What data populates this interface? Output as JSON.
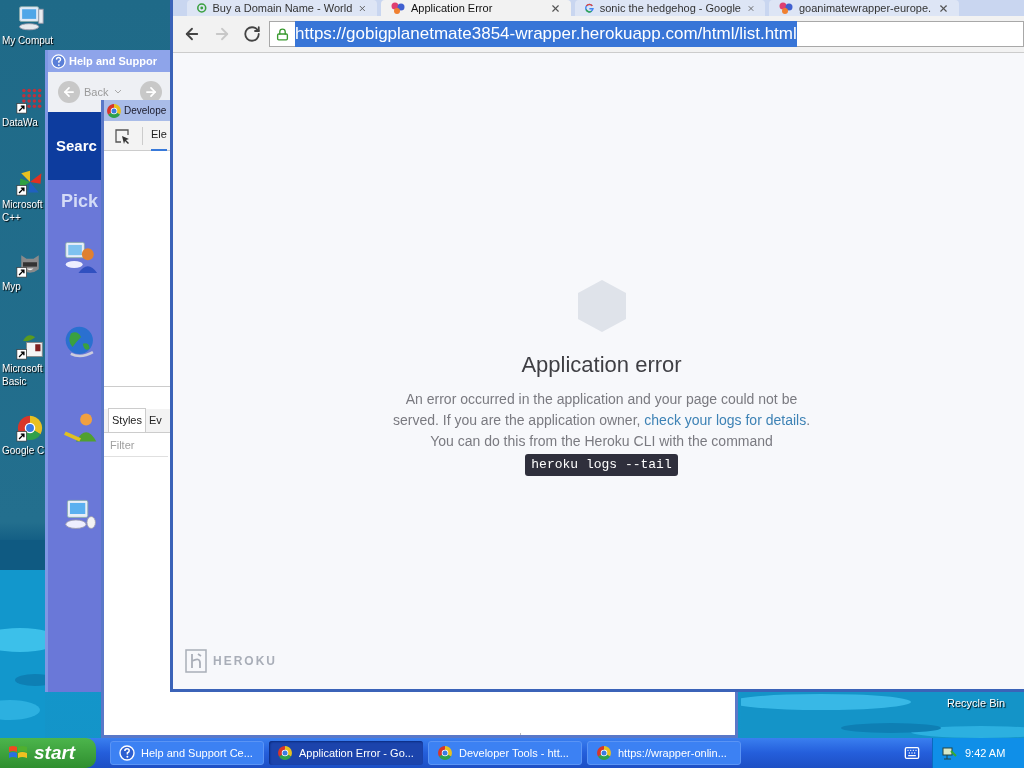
{
  "desktop": {
    "icons": [
      {
        "kind": "computer",
        "shortcut": false,
        "lines": [
          "My Comput"
        ]
      },
      {
        "kind": "dots",
        "shortcut": true,
        "lines": [
          "DataWa"
        ]
      },
      {
        "kind": "pinwheel",
        "shortcut": true,
        "lines": [
          "Microsoft",
          "C++"
        ]
      },
      {
        "kind": "animal",
        "shortcut": true,
        "lines": [
          "Myp"
        ]
      },
      {
        "kind": "leaf",
        "shortcut": true,
        "lines": [
          "Microsoft",
          "Basic"
        ]
      },
      {
        "kind": "tricolor",
        "shortcut": true,
        "lines": [
          "Google C"
        ]
      }
    ],
    "recycle_bin": {
      "label": "Recycle Bin"
    }
  },
  "help_window": {
    "title": "Help and Suppor",
    "back": "Back",
    "search_heading": "Searc",
    "pick_heading": "Pick",
    "items": [
      {
        "kind": "user-computer"
      },
      {
        "kind": "globe"
      },
      {
        "kind": "person"
      },
      {
        "kind": "computer"
      }
    ]
  },
  "devtools": {
    "title": "Develope",
    "panel_tab": "Ele",
    "sidebar_tabs": [
      {
        "label": "Styles",
        "selected": true
      },
      {
        "label": "Ev",
        "selected": false
      }
    ],
    "filter_placeholder": "Filter"
  },
  "browser": {
    "tabs": [
      {
        "kind": "ring",
        "label": "Buy a Domain Name - World",
        "selected": false
      },
      {
        "kind": "swirl",
        "label": "Application Error",
        "selected": true
      },
      {
        "kind": "g",
        "label": "sonic the hedgehog - Google",
        "selected": false
      },
      {
        "kind": "swirl",
        "label": "goanimatewrapper-europe.",
        "selected": false
      }
    ],
    "nav": [
      {
        "kind": "back",
        "disabled": false
      },
      {
        "kind": "forward",
        "disabled": true
      },
      {
        "kind": "reload",
        "disabled": false
      }
    ],
    "url": "https://gobigplanetmate3854-wrapper.herokuapp.com/html/list.html",
    "url_selected": true,
    "page": {
      "title": "Application error",
      "message": "An error occurred in the application and your page could not be served. If you are the application owner, ",
      "link": "check your logs for details",
      "message_end": ". You can do this from the Heroku CLI with the command",
      "command": "heroku logs --tail",
      "brand": "HEROKU"
    }
  },
  "taskbar": {
    "start": "start",
    "tasks": [
      {
        "kind": "help",
        "label": "Help and Support Ce...",
        "selected": false
      },
      {
        "kind": "chrome",
        "label": "Application Error - Go...",
        "selected": true
      },
      {
        "kind": "chrome",
        "label": "Developer Tools - htt...",
        "selected": false
      },
      {
        "kind": "chrome",
        "label": "https://wrapper-onlin...",
        "selected": false
      }
    ],
    "clock": "9:42 AM"
  }
}
